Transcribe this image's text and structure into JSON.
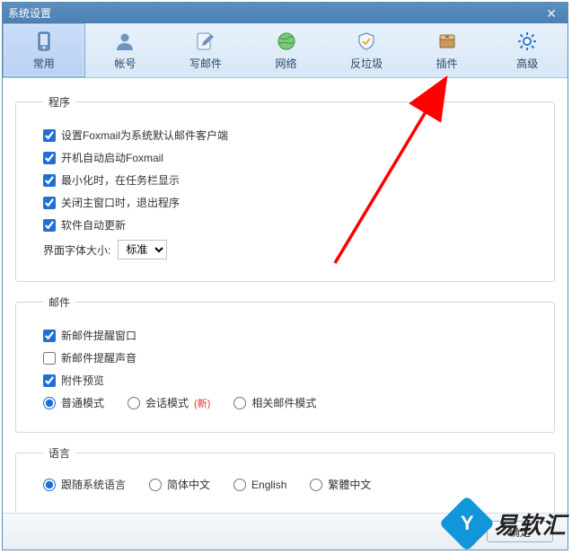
{
  "window": {
    "title": "系统设置"
  },
  "tabs": [
    {
      "label": "常用"
    },
    {
      "label": "帐号"
    },
    {
      "label": "写邮件"
    },
    {
      "label": "网络"
    },
    {
      "label": "反垃圾"
    },
    {
      "label": "插件"
    },
    {
      "label": "高级"
    }
  ],
  "groups": {
    "program": {
      "title": "程序",
      "checkboxes": [
        {
          "label": "设置Foxmail为系统默认邮件客户端",
          "checked": true
        },
        {
          "label": "开机自动启动Foxmail",
          "checked": true
        },
        {
          "label": "最小化时，在任务栏显示",
          "checked": true
        },
        {
          "label": "关闭主窗口时，退出程序",
          "checked": true
        },
        {
          "label": "软件自动更新",
          "checked": true
        }
      ],
      "fontsize_label": "界面字体大小:",
      "fontsize_value": "标准"
    },
    "mail": {
      "title": "邮件",
      "checkboxes": [
        {
          "label": "新邮件提醒窗口",
          "checked": true
        },
        {
          "label": "新邮件提醒声音",
          "checked": false
        },
        {
          "label": "附件预览",
          "checked": true
        }
      ],
      "mode_radios": [
        {
          "label": "普通模式",
          "checked": true,
          "new": false
        },
        {
          "label": "会话模式",
          "checked": false,
          "new": true,
          "new_text": "(新)"
        },
        {
          "label": "相关邮件模式",
          "checked": false,
          "new": false
        }
      ]
    },
    "language": {
      "title": "语言",
      "radios": [
        {
          "label": "跟随系统语言",
          "checked": true
        },
        {
          "label": "简体中文",
          "checked": false
        },
        {
          "label": "English",
          "checked": false
        },
        {
          "label": "繁體中文",
          "checked": false
        }
      ]
    }
  },
  "footer": {
    "ok": "确定"
  },
  "watermark": {
    "text": "易软汇"
  }
}
